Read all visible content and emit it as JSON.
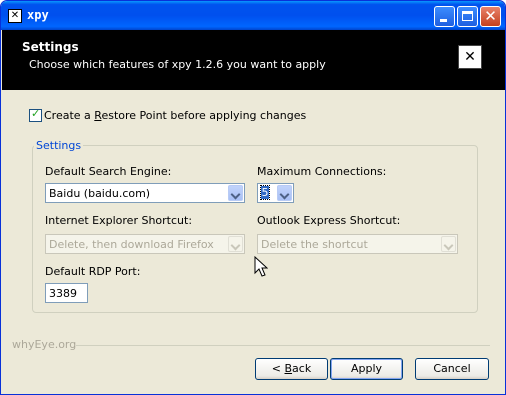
{
  "window": {
    "title": "xpy"
  },
  "header": {
    "title": "Settings",
    "subtitle": "Choose which features of xpy 1.2.6 you want to apply"
  },
  "restore_point": {
    "label_before": "Create a ",
    "label_accel": "R",
    "label_after": "estore Point before applying changes",
    "checked": true
  },
  "settings_group": {
    "label": "Settings",
    "search_engine": {
      "label": "Default Search Engine:",
      "value": "Baidu (baidu.com)"
    },
    "max_connections": {
      "label": "Maximum Connections:",
      "value": "5"
    },
    "ie_shortcut": {
      "label": "Internet Explorer Shortcut:",
      "value": "Delete, then download Firefox"
    },
    "oe_shortcut": {
      "label": "Outlook Express Shortcut:",
      "value": "Delete the shortcut"
    },
    "rdp_port": {
      "label": "Default RDP Port:",
      "value": "3389"
    }
  },
  "brand": "whyEye.org",
  "buttons": {
    "back_prefix": "< ",
    "back_accel": "B",
    "back_suffix": "ack",
    "apply": "Apply",
    "cancel": "Cancel"
  }
}
